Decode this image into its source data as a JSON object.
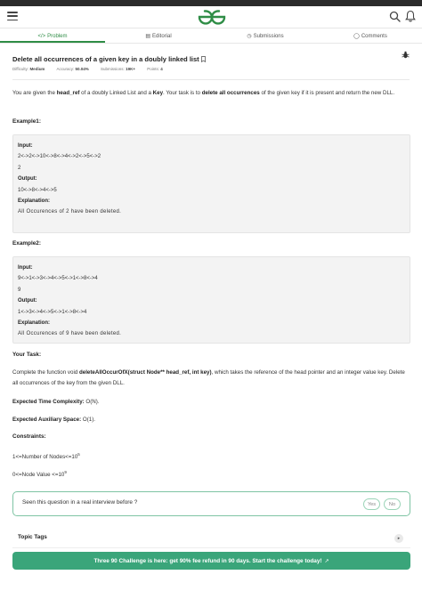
{
  "header": {
    "menu_icon": "hamburger-icon",
    "logo_icon": "gfg-logo",
    "search_icon": "search-icon",
    "bell_icon": "bell-icon",
    "brand_color": "#2f8d46"
  },
  "tabs": [
    {
      "label": "Problem",
      "icon": "</>",
      "active": true
    },
    {
      "label": "Editorial",
      "icon": "▤",
      "active": false
    },
    {
      "label": "Submissions",
      "icon": "◷",
      "active": false
    },
    {
      "label": "Comments",
      "icon": "◯",
      "active": false
    }
  ],
  "problem": {
    "title": "Delete all occurrences of a given key in a doubly linked list",
    "difficulty_label": "Difficulty:",
    "difficulty": "Medium",
    "accuracy_label": "Accuracy:",
    "accuracy": "50.04%",
    "submissions_label": "Submissions:",
    "submissions": "19K+",
    "points_label": "Points:",
    "points": "4"
  },
  "description": {
    "p1": "You are given the ",
    "head_ref": "head_ref",
    "p2": " of a doubly Linked List and a ",
    "key": "Key",
    "p3": ". Your task is to ",
    "delete_all": "delete all occurrences",
    "p4": " of the given key if it is present and return the new DLL."
  },
  "examples": [
    {
      "title": "Example1:",
      "input_label": "Input:",
      "input_list": "2<->2<->10<->8<->4<->2<->5<->2",
      "input_key": "2",
      "output_label": "Output:",
      "output": "10<->8<->4<->5",
      "explanation_label": "Explanation:",
      "explanation": "All Occurences of 2 have been deleted."
    },
    {
      "title": "Example2:",
      "input_label": "Input:",
      "input_list": "9<->1<->3<->4<->5<->1<->8<->4",
      "input_key": "9",
      "output_label": "Output:",
      "output": "1<->3<->4<->5<->1<->8<->4",
      "explanation_label": "Explanation:",
      "explanation": "All Occurences of 9 have been deleted."
    }
  ],
  "task": {
    "title": "Your Task:",
    "t1": "Complete the function void ",
    "func": "deleteAllOccurOfX(struct Node** head_ref, int key)",
    "t2": ", which takes the reference of the head pointer and an integer value key. Delete all occurrences of the key from the given DLL."
  },
  "complexity": {
    "time_label": "Expected Time Complexity:",
    "time_value": " O(N).",
    "space_label": "Expected Auxiliary Space:",
    "space_value": " O(1)."
  },
  "constraints": {
    "title": "Constraints:",
    "c1_base": "1<=Number of Nodes<=10",
    "c1_exp": "5",
    "c2_base": "0<=Node Value <=10",
    "c2_exp": "9"
  },
  "interview": {
    "question": "Seen this question in a real interview before ?",
    "yes": "Yes",
    "no": "No"
  },
  "topic_tags": {
    "label": "Topic Tags",
    "arrow": "▸"
  },
  "banner": {
    "text": "Three 90 Challenge is here: get 90% fee refund in 90 days. Start the challenge today!",
    "icon": "external-link-icon",
    "color": "#3aa57a"
  }
}
